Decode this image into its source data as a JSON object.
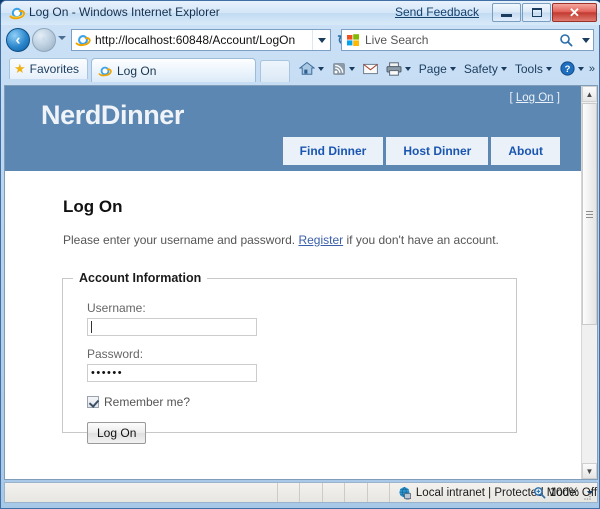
{
  "window": {
    "title": "Log On - Windows Internet Explorer",
    "feedback_label": "Send Feedback",
    "minimize_label": "Minimize",
    "maximize_label": "Maximize",
    "close_label": "✕"
  },
  "browser": {
    "back_label": "◄",
    "forward_label": "►",
    "address_value": "http://localhost:60848/Account/LogOn",
    "address_scheme": "http://",
    "address_rest": "localhost:60848/Account/LogOn",
    "refresh_label": "↻",
    "stop_label": "✕",
    "search_placeholder": "Live Search",
    "favorites_label": "Favorites",
    "tab_label": "Log On",
    "new_tab_label": "",
    "command_items": [
      {
        "label": "",
        "icon": "home-icon",
        "caret": true
      },
      {
        "label": "",
        "icon": "feeds-icon",
        "caret": true
      },
      {
        "label": "",
        "icon": "mail-icon",
        "caret": false
      },
      {
        "label": "",
        "icon": "print-icon",
        "caret": true
      },
      {
        "label": "Page",
        "icon": "",
        "caret": true
      },
      {
        "label": "Safety",
        "icon": "",
        "caret": true
      },
      {
        "label": "Tools",
        "icon": "",
        "caret": true
      },
      {
        "label": "",
        "icon": "help-icon",
        "caret": true
      }
    ],
    "overflow_label": "»"
  },
  "page": {
    "brand": "NerdDinner",
    "corner": {
      "open_bracket": "[",
      "link_label": "Log On",
      "close_bracket": "]"
    },
    "nav_tabs": [
      {
        "label": "Find Dinner"
      },
      {
        "label": "Host Dinner"
      },
      {
        "label": "About"
      }
    ],
    "heading": "Log On",
    "intro_before": "Please enter your username and password. ",
    "intro_link": "Register",
    "intro_after": " if you don't have an account.",
    "fieldset_legend": "Account Information",
    "username": {
      "label": "Username:",
      "value": ""
    },
    "password": {
      "label": "Password:",
      "value": "••••••"
    },
    "remember": {
      "label": "Remember me?",
      "checked": true
    },
    "submit_label": "Log On",
    "accent_color": "#5c87b2",
    "link_color": "#1a56b0"
  },
  "status": {
    "zone_text": "Local intranet | Protected Mode: Off",
    "zoom_level": "100%"
  }
}
